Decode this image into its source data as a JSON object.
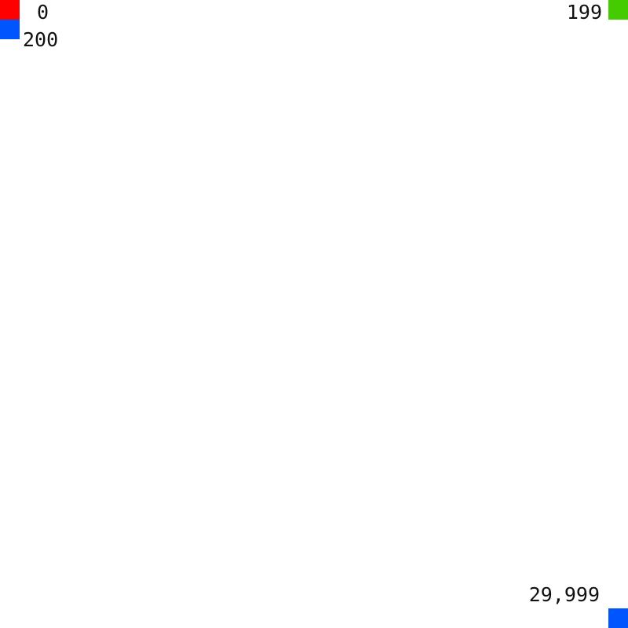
{
  "markers": [
    {
      "id": "first",
      "index_label": "0",
      "color": "#ff0000"
    },
    {
      "id": "end-of-first-row",
      "index_label": "199",
      "color": "#44cc00"
    },
    {
      "id": "start-of-second-row",
      "index_label": "200",
      "color": "#0055ff"
    },
    {
      "id": "last",
      "index_label": "29,999",
      "color": "#0055ff"
    }
  ]
}
